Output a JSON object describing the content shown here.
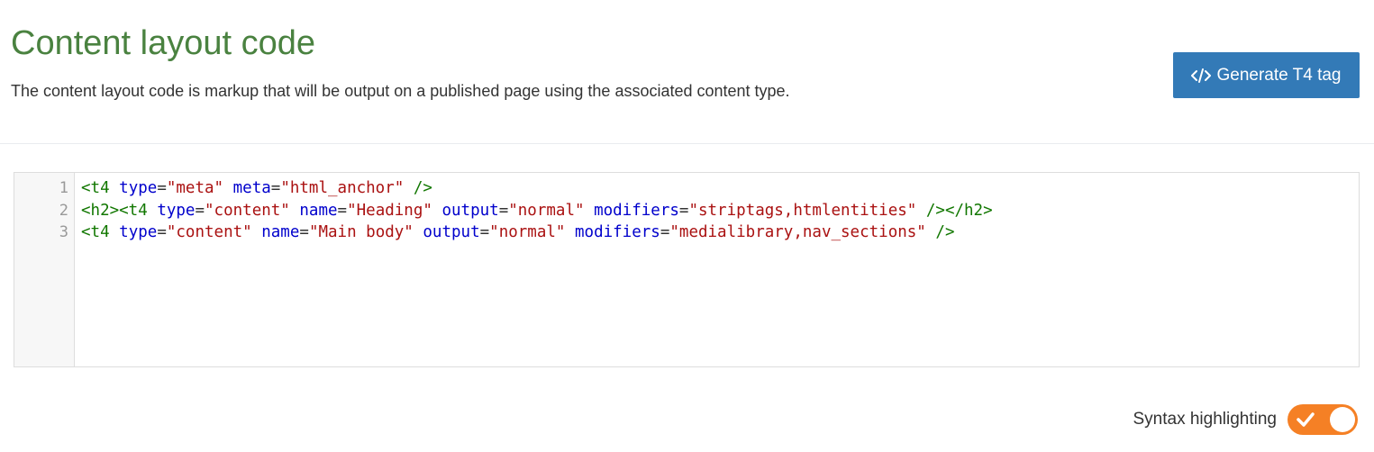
{
  "header": {
    "title": "Content layout code",
    "description": "The content layout code is markup that will be output on a published page using the associated content type.",
    "generate_button": {
      "icon": "code-icon",
      "label": "Generate T4 tag"
    }
  },
  "editor": {
    "line_numbers": [
      "1",
      "2",
      "3"
    ],
    "lines": [
      [
        {
          "t": "tag",
          "v": "<t4"
        },
        {
          "t": "plain",
          "v": " "
        },
        {
          "t": "attr",
          "v": "type"
        },
        {
          "t": "plain",
          "v": "="
        },
        {
          "t": "str",
          "v": "\"meta\""
        },
        {
          "t": "plain",
          "v": " "
        },
        {
          "t": "attr",
          "v": "meta"
        },
        {
          "t": "plain",
          "v": "="
        },
        {
          "t": "str",
          "v": "\"html_anchor\""
        },
        {
          "t": "plain",
          "v": " "
        },
        {
          "t": "tag",
          "v": "/>"
        }
      ],
      [
        {
          "t": "tag",
          "v": "<h2><t4"
        },
        {
          "t": "plain",
          "v": " "
        },
        {
          "t": "attr",
          "v": "type"
        },
        {
          "t": "plain",
          "v": "="
        },
        {
          "t": "str",
          "v": "\"content\""
        },
        {
          "t": "plain",
          "v": " "
        },
        {
          "t": "attr",
          "v": "name"
        },
        {
          "t": "plain",
          "v": "="
        },
        {
          "t": "str",
          "v": "\"Heading\""
        },
        {
          "t": "plain",
          "v": " "
        },
        {
          "t": "attr",
          "v": "output"
        },
        {
          "t": "plain",
          "v": "="
        },
        {
          "t": "str",
          "v": "\"normal\""
        },
        {
          "t": "plain",
          "v": " "
        },
        {
          "t": "attr",
          "v": "modifiers"
        },
        {
          "t": "plain",
          "v": "="
        },
        {
          "t": "str",
          "v": "\"striptags,htmlentities\""
        },
        {
          "t": "plain",
          "v": " "
        },
        {
          "t": "tag",
          "v": "/></h2>"
        }
      ],
      [
        {
          "t": "tag",
          "v": "<t4"
        },
        {
          "t": "plain",
          "v": " "
        },
        {
          "t": "attr",
          "v": "type"
        },
        {
          "t": "plain",
          "v": "="
        },
        {
          "t": "str",
          "v": "\"content\""
        },
        {
          "t": "plain",
          "v": " "
        },
        {
          "t": "attr",
          "v": "name"
        },
        {
          "t": "plain",
          "v": "="
        },
        {
          "t": "str",
          "v": "\"Main body\""
        },
        {
          "t": "plain",
          "v": " "
        },
        {
          "t": "attr",
          "v": "output"
        },
        {
          "t": "plain",
          "v": "="
        },
        {
          "t": "str",
          "v": "\"normal\""
        },
        {
          "t": "plain",
          "v": " "
        },
        {
          "t": "attr",
          "v": "modifiers"
        },
        {
          "t": "plain",
          "v": "="
        },
        {
          "t": "str",
          "v": "\"medialibrary,nav_sections\""
        },
        {
          "t": "plain",
          "v": " "
        },
        {
          "t": "tag",
          "v": "/>"
        }
      ]
    ]
  },
  "syntax_toggle": {
    "label": "Syntax highlighting",
    "enabled": true,
    "icon": "check-icon"
  },
  "colors": {
    "title_green": "#4a8240",
    "button_blue": "#337ab7",
    "toggle_orange": "#f58025",
    "code_tag": "#117700",
    "code_attr": "#0000cc",
    "code_string": "#aa1111"
  }
}
